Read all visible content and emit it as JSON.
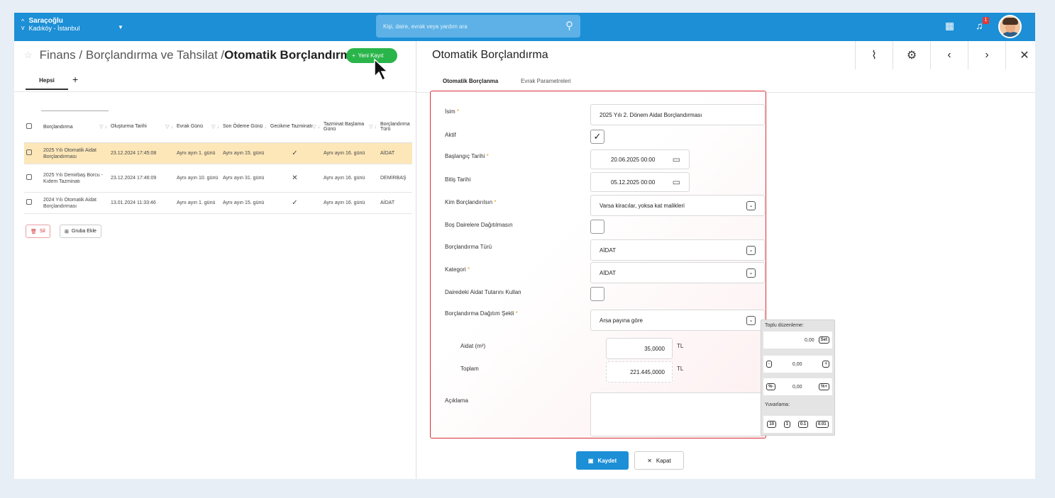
{
  "topbar": {
    "location_name": "Saraçoğlu",
    "location_sub": "Kadıköy - İstanbul",
    "search_placeholder": "Kişi, daire, evrak veya yardım ara",
    "notification_count": "1"
  },
  "left": {
    "breadcrumb_prefix": "Finans / Borçlandırma ve Tahsilat / ",
    "breadcrumb_current": "Otomatik Borçlandırma",
    "new_button": "Yeni Kayıt",
    "tab_all": "Hepsi",
    "tab_add": "+",
    "columns": [
      "Borçlandırma",
      "Oluşturma Tarihi",
      "Evrak Günü",
      "Son Ödeme Günü",
      "Gecikme Tazminatı",
      "Tazminat Başlama Günü",
      "Borçlandırma Türü"
    ],
    "rows": [
      {
        "name": "2025 Yılı Otomatik Aidat Borçlandırması",
        "created": "23.12.2024 17:45:08",
        "doc_day": "Aynı ayın 1. günü",
        "due_day": "Aynı ayın 15. günü",
        "late_fee": "✓",
        "fee_start": "Aynı ayın 16. günü",
        "type": "AİDAT"
      },
      {
        "name": "2025 Yılı Demirbaş Borcu - Kıdem Tazminatı",
        "created": "23.12.2024 17:46:09",
        "doc_day": "Aynı ayın 10. günü",
        "due_day": "Aynı ayın 31. günü",
        "late_fee": "✕",
        "fee_start": "Aynı ayın 16. günü",
        "type": "DEMİRBAŞ"
      },
      {
        "name": "2024 Yılı Otomatik Aidat Borçlandırması",
        "created": "13.01.2024 11:33:46",
        "doc_day": "Aynı ayın 1. günü",
        "due_day": "Aynı ayın 15. günü",
        "late_fee": "✓",
        "fee_start": "Aynı ayın 16. günü",
        "type": "AİDAT"
      }
    ],
    "delete_button": "Sil",
    "group_button": "Gruba Ekle"
  },
  "right": {
    "title": "Otomatik Borçlandırma",
    "tabs": [
      "Otomatik Borçlanma",
      "Evrak Parametreleri"
    ],
    "form": {
      "name_label": "İsim",
      "name_value": "2025 Yılı 2. Dönem Aidat Borçlandırması",
      "active_label": "Aktif",
      "active_checked": true,
      "start_label": "Başlangıç Tarihi",
      "start_value": "20.06.2025 00:00",
      "end_label": "Bitiş Tarihi",
      "end_value": "05.12.2025 00:00",
      "who_label": "Kim Borçlandırılsın",
      "who_value": "Varsa kiracılar, yoksa kat malikleri",
      "empty_label": "Boş Dairelere Dağıtılmasın",
      "type_label": "Borçlandırma Türü",
      "type_value": "AİDAT",
      "category_label": "Kategori",
      "category_value": "AİDAT",
      "use_amount_label": "Dairedeki Aidat Tutarını Kullan",
      "dist_label": "Borçlandırma Dağıtım Şekli",
      "dist_value": "Arsa payına göre",
      "aidat_label": "Aidat (m²)",
      "aidat_value": "35,0000",
      "total_label": "Toplam",
      "total_value": "221.445,0000",
      "currency": "TL",
      "desc_label": "Açıklama"
    },
    "save_button": "Kaydet",
    "close_button": "Kapat"
  },
  "bulk_panel": {
    "title": "Toplu düzenleme:",
    "set_value": "0,00",
    "set_label": "Set",
    "step_value": "0,00",
    "minus": "-",
    "plus": "+",
    "pct_value": "0,00",
    "pct_minus": "%-",
    "pct_plus": "%+",
    "round_title": "Yuvarlama:",
    "round_options": [
      "10",
      "1",
      "0.1",
      "0.01"
    ]
  },
  "colors": {
    "primary": "#1c8fd6",
    "success": "#2ab54a",
    "highlight_row": "#fde7b9",
    "form_border": "#d6303a"
  }
}
